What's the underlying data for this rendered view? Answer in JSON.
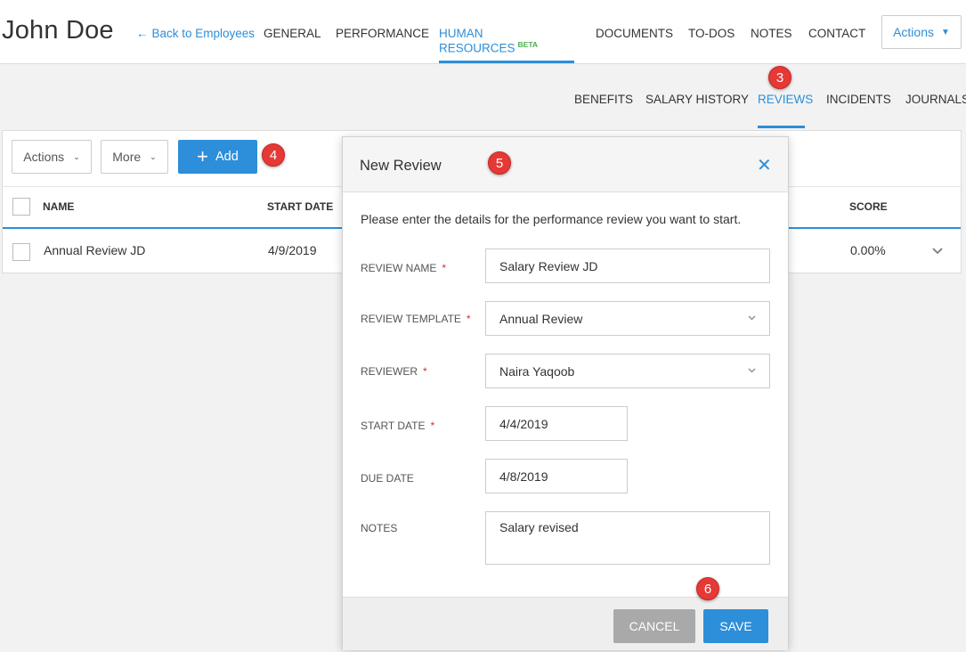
{
  "header": {
    "employee_name": "John Doe",
    "back_label": "Back to Employees",
    "nav": [
      {
        "label": "GENERAL"
      },
      {
        "label": "PERFORMANCE"
      },
      {
        "label": "HUMAN RESOURCES",
        "badge": "BETA"
      },
      {
        "label": "DOCUMENTS"
      },
      {
        "label": "TO-DOs"
      },
      {
        "label": "NOTES"
      },
      {
        "label": "CONTACT"
      }
    ],
    "actions_label": "Actions"
  },
  "subnav": [
    {
      "label": "BENEFITS"
    },
    {
      "label": "SALARY HISTORY"
    },
    {
      "label": "REVIEWS"
    },
    {
      "label": "INCIDENTS"
    },
    {
      "label": "JOURNALS"
    }
  ],
  "toolbar": {
    "actions_label": "Actions",
    "more_label": "More",
    "add_label": "Add"
  },
  "table": {
    "columns": [
      "NAME",
      "START DATE",
      "SCORE"
    ],
    "rows": [
      {
        "name": "Annual Review JD",
        "start_date": "4/9/2019",
        "score": "0.00%"
      }
    ]
  },
  "modal": {
    "title": "New Review",
    "intro": "Please enter the details for the performance review you want to start.",
    "fields": {
      "review_name": {
        "label": "REVIEW NAME",
        "value": "Salary Review JD"
      },
      "review_template": {
        "label": "REVIEW TEMPLATE",
        "value": "Annual Review"
      },
      "reviewer": {
        "label": "REVIEWER",
        "value": "Naira Yaqoob"
      },
      "start_date": {
        "label": "START DATE",
        "value": "4/4/2019"
      },
      "due_date": {
        "label": "DUE DATE",
        "value": "4/8/2019"
      },
      "notes": {
        "label": "NOTES",
        "value": "Salary revised"
      }
    },
    "required_mark": "*",
    "cancel_label": "CANCEL",
    "save_label": "SAVE"
  },
  "steps": {
    "reviews_tab": "3",
    "add_button": "4",
    "modal_title": "5",
    "save_button": "6"
  },
  "colors": {
    "accent": "#2d8ed9",
    "badge_red": "#e53935",
    "beta_green": "#4caf50"
  }
}
